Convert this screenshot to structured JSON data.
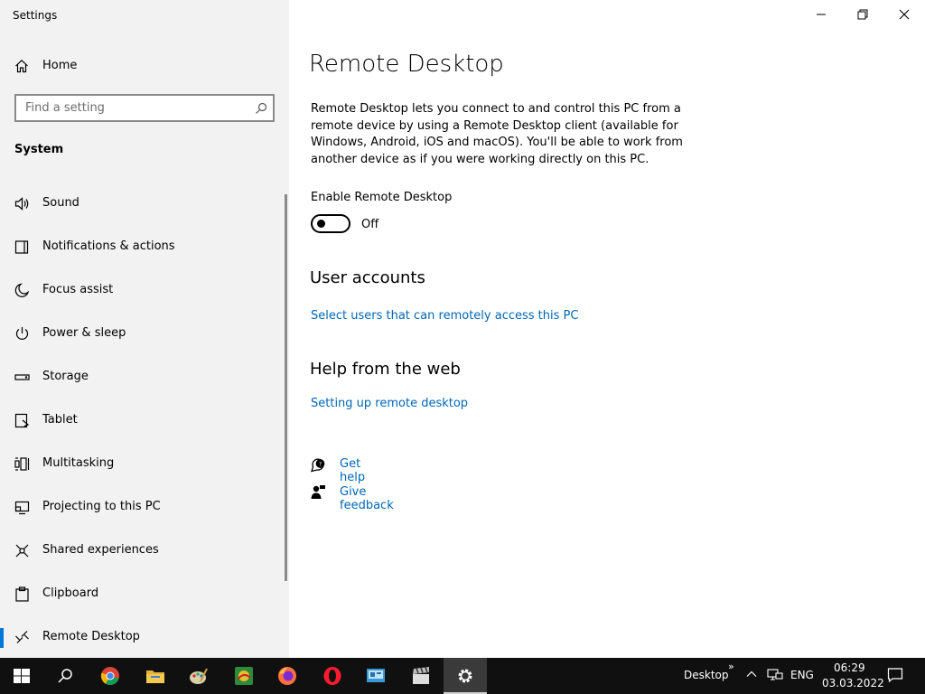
{
  "window": {
    "title": "Settings",
    "controls": [
      "minimize",
      "restore",
      "close"
    ]
  },
  "sidebar": {
    "home_label": "Home",
    "search_placeholder": "Find a setting",
    "section_title": "System",
    "items": [
      {
        "label": "Sound",
        "icon": "speaker-icon"
      },
      {
        "label": "Notifications & actions",
        "icon": "notifications-icon"
      },
      {
        "label": "Focus assist",
        "icon": "moon-icon"
      },
      {
        "label": "Power & sleep",
        "icon": "power-icon"
      },
      {
        "label": "Storage",
        "icon": "storage-icon"
      },
      {
        "label": "Tablet",
        "icon": "tablet-icon"
      },
      {
        "label": "Multitasking",
        "icon": "multitasking-icon"
      },
      {
        "label": "Projecting to this PC",
        "icon": "projecting-icon"
      },
      {
        "label": "Shared experiences",
        "icon": "shared-experiences-icon"
      },
      {
        "label": "Clipboard",
        "icon": "clipboard-icon"
      },
      {
        "label": "Remote Desktop",
        "icon": "remote-desktop-icon",
        "active": true
      }
    ]
  },
  "main": {
    "title": "Remote Desktop",
    "description": "Remote Desktop lets you connect to and control this PC from a remote device by using a Remote Desktop client (available for Windows, Android, iOS and macOS). You'll be able to work from another device as if you were working directly on this PC.",
    "enable_label": "Enable Remote Desktop",
    "toggle_state": "Off",
    "user_accounts": {
      "heading": "User accounts",
      "link": "Select users that can remotely access this PC"
    },
    "help_web": {
      "heading": "Help from the web",
      "link": "Setting up remote desktop"
    },
    "get_help": "Get help",
    "give_feedback": "Give feedback"
  },
  "taskbar": {
    "apps": [
      "start-button",
      "search-button",
      "chrome",
      "file-explorer",
      "paint",
      "app",
      "firefox",
      "opera",
      "control-panel",
      "video-editor",
      "settings"
    ],
    "desktop_label": "Desktop",
    "overflow": "»",
    "language": "ENG",
    "time": "06:29",
    "date": "03.03.2022"
  },
  "colors": {
    "sidebar_bg": "#f2f2f2",
    "accent": "#0078d7",
    "link": "#0067b8",
    "taskbar_bg": "#101010"
  }
}
